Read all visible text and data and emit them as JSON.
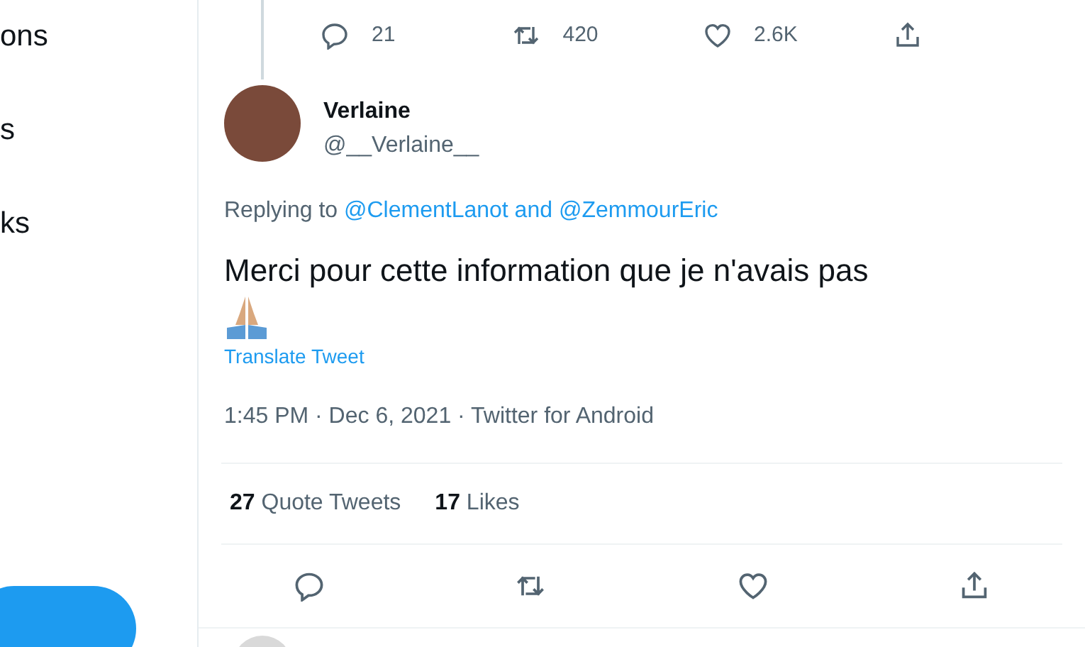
{
  "sidebar": {
    "items": [
      {
        "label": "ons"
      },
      {
        "label": "s"
      },
      {
        "label": "ks"
      }
    ]
  },
  "previous_tweet": {
    "actions": [
      {
        "kind": "reply",
        "count": "21"
      },
      {
        "kind": "retweet",
        "count": "420"
      },
      {
        "kind": "like",
        "count": "2.6K"
      },
      {
        "kind": "share"
      }
    ]
  },
  "tweet": {
    "name": "Verlaine",
    "handle": "@__Verlaine__",
    "replying_prefix": "Replying to",
    "replying_to": [
      "@ClementLanot",
      "@ZemmourEric"
    ],
    "replying_joiner": "and",
    "text": "Merci pour cette information que je n'avais pas",
    "translate": "Translate Tweet",
    "timestamp": "1:45 PM · Dec 6, 2021 · Twitter for Android",
    "stats": [
      {
        "count": "27",
        "label": "Quote Tweets"
      },
      {
        "count": "17",
        "label": "Likes"
      }
    ],
    "actions": [
      {
        "kind": "reply"
      },
      {
        "kind": "retweet"
      },
      {
        "kind": "like"
      },
      {
        "kind": "share"
      }
    ]
  }
}
